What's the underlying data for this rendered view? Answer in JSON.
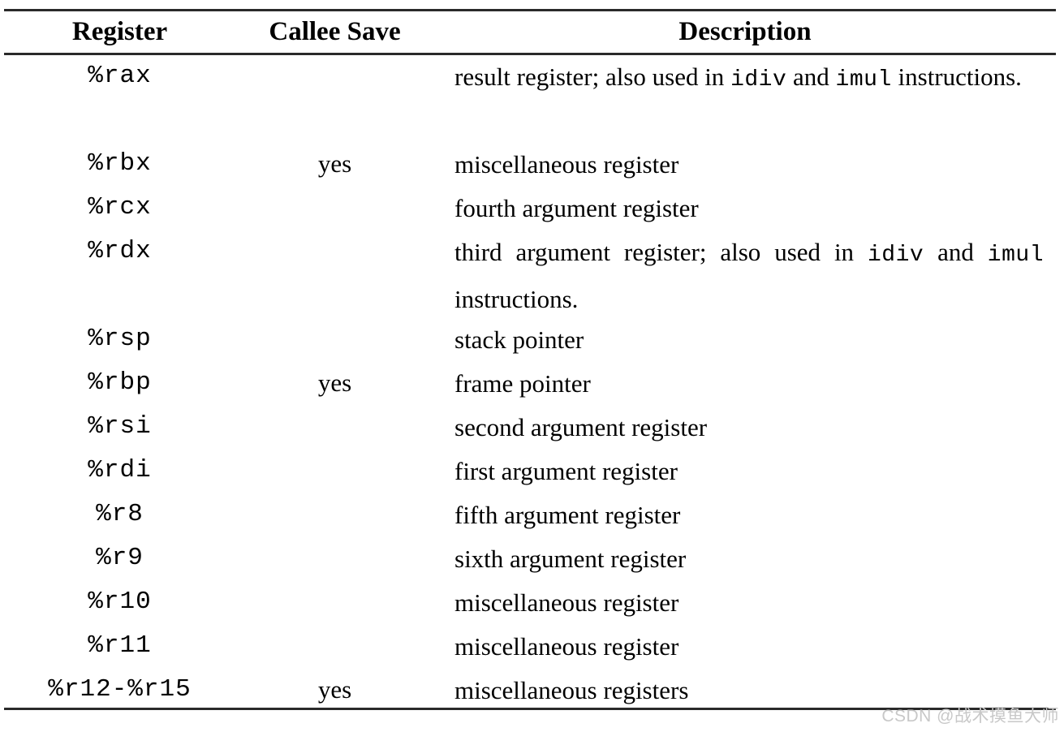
{
  "document": {
    "type": "x86-64 register reference table",
    "columns": [
      "Register",
      "Callee Save",
      "Description"
    ]
  },
  "table": {
    "headers": {
      "register": "Register",
      "callee_save": "Callee Save",
      "description": "Description"
    },
    "rows": [
      {
        "register": "%rax",
        "callee_save": "",
        "description_parts": [
          {
            "text": "result register; also used in ",
            "mono": false
          },
          {
            "text": "idiv",
            "mono": true
          },
          {
            "text": " and ",
            "mono": false
          },
          {
            "text": "imul",
            "mono": true
          },
          {
            "text": " instructions.",
            "mono": false
          }
        ],
        "description_plain": "result register; also used in idiv and imul instructions.",
        "lines": 2,
        "justified": true
      },
      {
        "register": "%rbx",
        "callee_save": "yes",
        "description_parts": [
          {
            "text": "miscellaneous register",
            "mono": false
          }
        ],
        "description_plain": "miscellaneous register",
        "lines": 1,
        "justified": false
      },
      {
        "register": "%rcx",
        "callee_save": "",
        "description_parts": [
          {
            "text": "fourth argument register",
            "mono": false
          }
        ],
        "description_plain": "fourth argument register",
        "lines": 1,
        "justified": false
      },
      {
        "register": "%rdx",
        "callee_save": "",
        "description_parts": [
          {
            "text": "third argument register; also used in ",
            "mono": false
          },
          {
            "text": "idiv",
            "mono": true
          },
          {
            "text": " and ",
            "mono": false
          },
          {
            "text": "imul",
            "mono": true
          },
          {
            "text": " instructions.",
            "mono": false
          }
        ],
        "description_plain": "third argument register; also used in idiv and imul instructions.",
        "lines": 2,
        "justified": true
      },
      {
        "register": "%rsp",
        "callee_save": "",
        "description_parts": [
          {
            "text": "stack pointer",
            "mono": false
          }
        ],
        "description_plain": "stack pointer",
        "lines": 1,
        "justified": false
      },
      {
        "register": "%rbp",
        "callee_save": "yes",
        "description_parts": [
          {
            "text": "frame pointer",
            "mono": false
          }
        ],
        "description_plain": "frame pointer",
        "lines": 1,
        "justified": false
      },
      {
        "register": "%rsi",
        "callee_save": "",
        "description_parts": [
          {
            "text": "second argument register",
            "mono": false
          }
        ],
        "description_plain": "second argument register",
        "lines": 1,
        "justified": false
      },
      {
        "register": "%rdi",
        "callee_save": "",
        "description_parts": [
          {
            "text": "first argument register",
            "mono": false
          }
        ],
        "description_plain": "first argument register",
        "lines": 1,
        "justified": false
      },
      {
        "register": "%r8",
        "callee_save": "",
        "description_parts": [
          {
            "text": "fifth argument register",
            "mono": false
          }
        ],
        "description_plain": "fifth argument register",
        "lines": 1,
        "justified": false
      },
      {
        "register": "%r9",
        "callee_save": "",
        "description_parts": [
          {
            "text": "sixth argument register",
            "mono": false
          }
        ],
        "description_plain": "sixth argument register",
        "lines": 1,
        "justified": false
      },
      {
        "register": "%r10",
        "callee_save": "",
        "description_parts": [
          {
            "text": "miscellaneous register",
            "mono": false
          }
        ],
        "description_plain": "miscellaneous register",
        "lines": 1,
        "justified": false
      },
      {
        "register": "%r11",
        "callee_save": "",
        "description_parts": [
          {
            "text": "miscellaneous register",
            "mono": false
          }
        ],
        "description_plain": "miscellaneous register",
        "lines": 1,
        "justified": false
      },
      {
        "register": "%r12-%r15",
        "callee_save": "yes",
        "description_parts": [
          {
            "text": "miscellaneous registers",
            "mono": false
          }
        ],
        "description_plain": "miscellaneous registers",
        "lines": 1,
        "justified": false
      }
    ]
  },
  "watermark": {
    "text": "CSDN @战术摸鱼大师",
    "color": "#c8c8c8"
  },
  "colors": {
    "background": "#ffffff",
    "text": "#000000",
    "rule": "#2a2a2a"
  }
}
